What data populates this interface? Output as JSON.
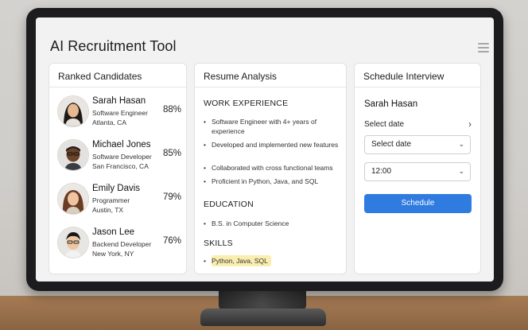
{
  "app": {
    "title": "AI Recruitment Tool"
  },
  "candidates_panel": {
    "title": "Ranked Candidates",
    "candidates": [
      {
        "name": "Sarah Hasan",
        "role": "Software Engineer",
        "location": "Atlanta, CA",
        "score": "88%"
      },
      {
        "name": "Michael Jones",
        "role": "Software Developer",
        "location": "San Francisco, CA",
        "score": "85%"
      },
      {
        "name": "Emily Davis",
        "role": "Programmer",
        "location": "Austin, TX",
        "score": "79%"
      },
      {
        "name": "Jason Lee",
        "role": "Backend Developer",
        "location": "New York, NY",
        "score": "76%"
      }
    ]
  },
  "resume_panel": {
    "title": "Resume Analysis",
    "work_heading": "WORK EXPERIENCE",
    "work_items": [
      "Software Engineer with 4+ years of experience",
      "Developed and implemented new features",
      "Collaborated with cross functional teams",
      "Proficient in Python, Java, and SQL"
    ],
    "education_heading": "EDUCATION",
    "education_items": [
      "B.S. in Computer Science"
    ],
    "skills_heading": "SKILLS",
    "skills_items": [
      "Python, Java, SQL"
    ]
  },
  "schedule_panel": {
    "title": "Schedule Interview",
    "candidate_name": "Sarah Hasan",
    "date_label": "Select date",
    "date_select_value": "Select date",
    "time_select_value": "12:00",
    "button_label": "Schedule"
  },
  "colors": {
    "accent": "#2f7be0",
    "skill_highlight": "#f9edb0"
  },
  "icons": {
    "menu": "hamburger-icon",
    "chevron": "chevron-right-icon",
    "caret": "chevron-down-icon"
  }
}
